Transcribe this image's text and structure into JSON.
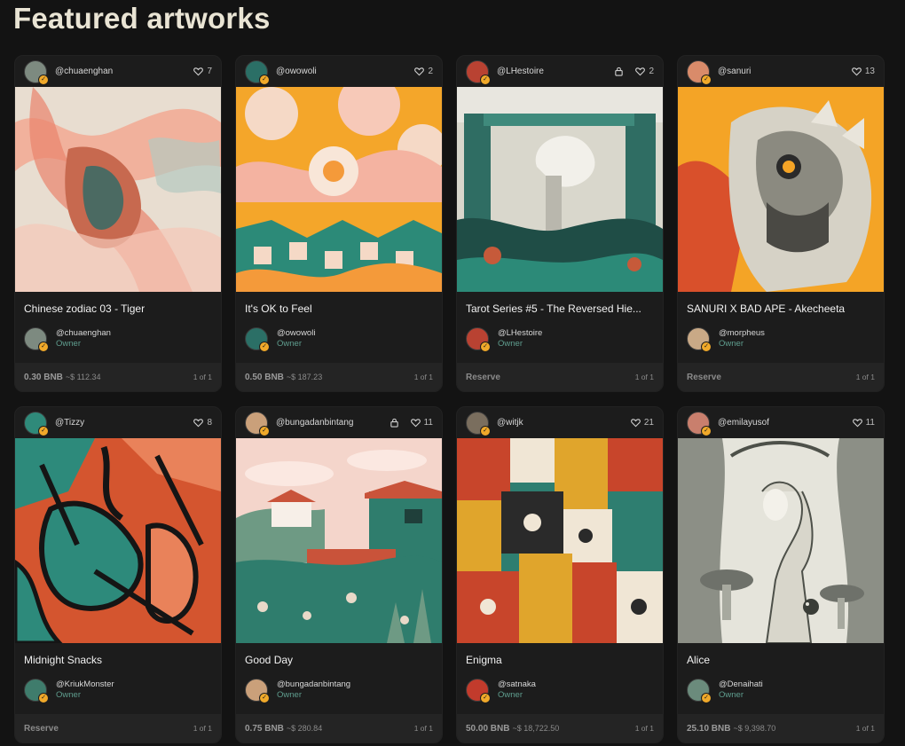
{
  "page": {
    "title": "Featured artworks"
  },
  "cards": [
    {
      "creator": "@chuaenghan",
      "likes": "7",
      "locked": false,
      "title": "Chinese zodiac 03 - Tiger",
      "owner": "@chuaenghan",
      "role": "Owner",
      "price": "0.30 BNB",
      "usd": "~$ 112.34",
      "edition": "1 of 1",
      "avatar_color": "#7d8a80",
      "owner_avatar_color": "#7d8a80"
    },
    {
      "creator": "@owowoli",
      "likes": "2",
      "locked": false,
      "title": "It's OK to Feel",
      "owner": "@owowoli",
      "role": "Owner",
      "price": "0.50 BNB",
      "usd": "~$ 187.23",
      "edition": "1 of 1",
      "avatar_color": "#2b6f66",
      "owner_avatar_color": "#2b6f66"
    },
    {
      "creator": "@LHestoire",
      "likes": "2",
      "locked": true,
      "title": "Tarot Series #5 - The Reversed Hie...",
      "owner": "@LHestoire",
      "role": "Owner",
      "price": "Reserve",
      "usd": "",
      "edition": "1 of 1",
      "avatar_color": "#b94232",
      "owner_avatar_color": "#b94232"
    },
    {
      "creator": "@sanuri",
      "likes": "13",
      "locked": false,
      "title": "SANURI X BAD APE - Akecheeta",
      "owner": "@morpheus",
      "role": "Owner",
      "price": "Reserve",
      "usd": "",
      "edition": "1 of 1",
      "avatar_color": "#d98b6a",
      "owner_avatar_color": "#c9a986"
    },
    {
      "creator": "@Tizzy",
      "likes": "8",
      "locked": false,
      "title": "Midnight Snacks",
      "owner": "@KriukMonster",
      "role": "Owner",
      "price": "Reserve",
      "usd": "",
      "edition": "1 of 1",
      "avatar_color": "#2f8a7a",
      "owner_avatar_color": "#3f7c6c"
    },
    {
      "creator": "@bungadanbintang",
      "likes": "11",
      "locked": true,
      "title": "Good Day",
      "owner": "@bungadanbintang",
      "role": "Owner",
      "price": "0.75 BNB",
      "usd": "~$ 280.84",
      "edition": "1 of 1",
      "avatar_color": "#caa07a",
      "owner_avatar_color": "#caa07a"
    },
    {
      "creator": "@witjk",
      "likes": "21",
      "locked": false,
      "title": "Enigma",
      "owner": "@satnaka",
      "role": "Owner",
      "price": "50.00 BNB",
      "usd": "~$ 18,722.50",
      "edition": "1 of 1",
      "avatar_color": "#7a6e5e",
      "owner_avatar_color": "#c23b2c"
    },
    {
      "creator": "@emilayusof",
      "likes": "11",
      "locked": false,
      "title": "Alice",
      "owner": "@Denaihati",
      "role": "Owner",
      "price": "25.10 BNB",
      "usd": "~$ 9,398.70",
      "edition": "1 of 1",
      "avatar_color": "#c97f6d",
      "owner_avatar_color": "#6b8b7c"
    }
  ]
}
